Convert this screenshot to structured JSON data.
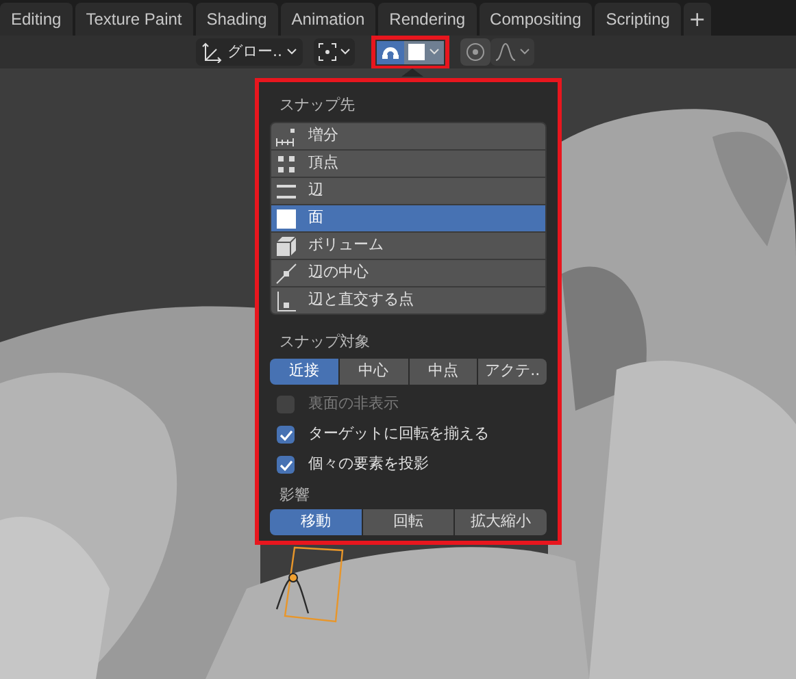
{
  "tabs": [
    {
      "label": "Editing",
      "selected": false
    },
    {
      "label": "Texture Paint",
      "selected": false
    },
    {
      "label": "Shading",
      "selected": false
    },
    {
      "label": "Animation",
      "selected": false
    },
    {
      "label": "Rendering",
      "selected": false
    },
    {
      "label": "Compositing",
      "selected": false
    },
    {
      "label": "Scripting",
      "selected": false
    }
  ],
  "add_tab": "+",
  "toolbar": {
    "orientation": "グロー..",
    "snap_on": true,
    "proportional_on": false
  },
  "snap_popup": {
    "snap_to_title": "スナップ先",
    "snap_to": [
      {
        "label": "増分",
        "kind": "increment",
        "selected": false
      },
      {
        "label": "頂点",
        "kind": "vertex",
        "selected": false
      },
      {
        "label": "辺",
        "kind": "edge",
        "selected": false
      },
      {
        "label": "面",
        "kind": "face",
        "selected": true
      },
      {
        "label": "ボリューム",
        "kind": "volume",
        "selected": false
      },
      {
        "label": "辺の中心",
        "kind": "midpoint",
        "selected": false
      },
      {
        "label": "辺と直交する点",
        "kind": "perpendicular",
        "selected": false
      }
    ],
    "target_title": "スナップ対象",
    "targets": [
      {
        "label": "近接",
        "selected": true
      },
      {
        "label": "中心",
        "selected": false
      },
      {
        "label": "中点",
        "selected": false
      },
      {
        "label": "アクテ..",
        "selected": false
      }
    ],
    "options": [
      {
        "label": "裏面の非表示",
        "checked": false,
        "disabled": true
      },
      {
        "label": "ターゲットに回転を揃える",
        "checked": true,
        "disabled": false
      },
      {
        "label": "個々の要素を投影",
        "checked": true,
        "disabled": false
      }
    ],
    "affect_title": "影響",
    "affect": [
      {
        "label": "移動",
        "selected": true
      },
      {
        "label": "回転",
        "selected": false
      },
      {
        "label": "拡大縮小",
        "selected": false
      }
    ]
  }
}
